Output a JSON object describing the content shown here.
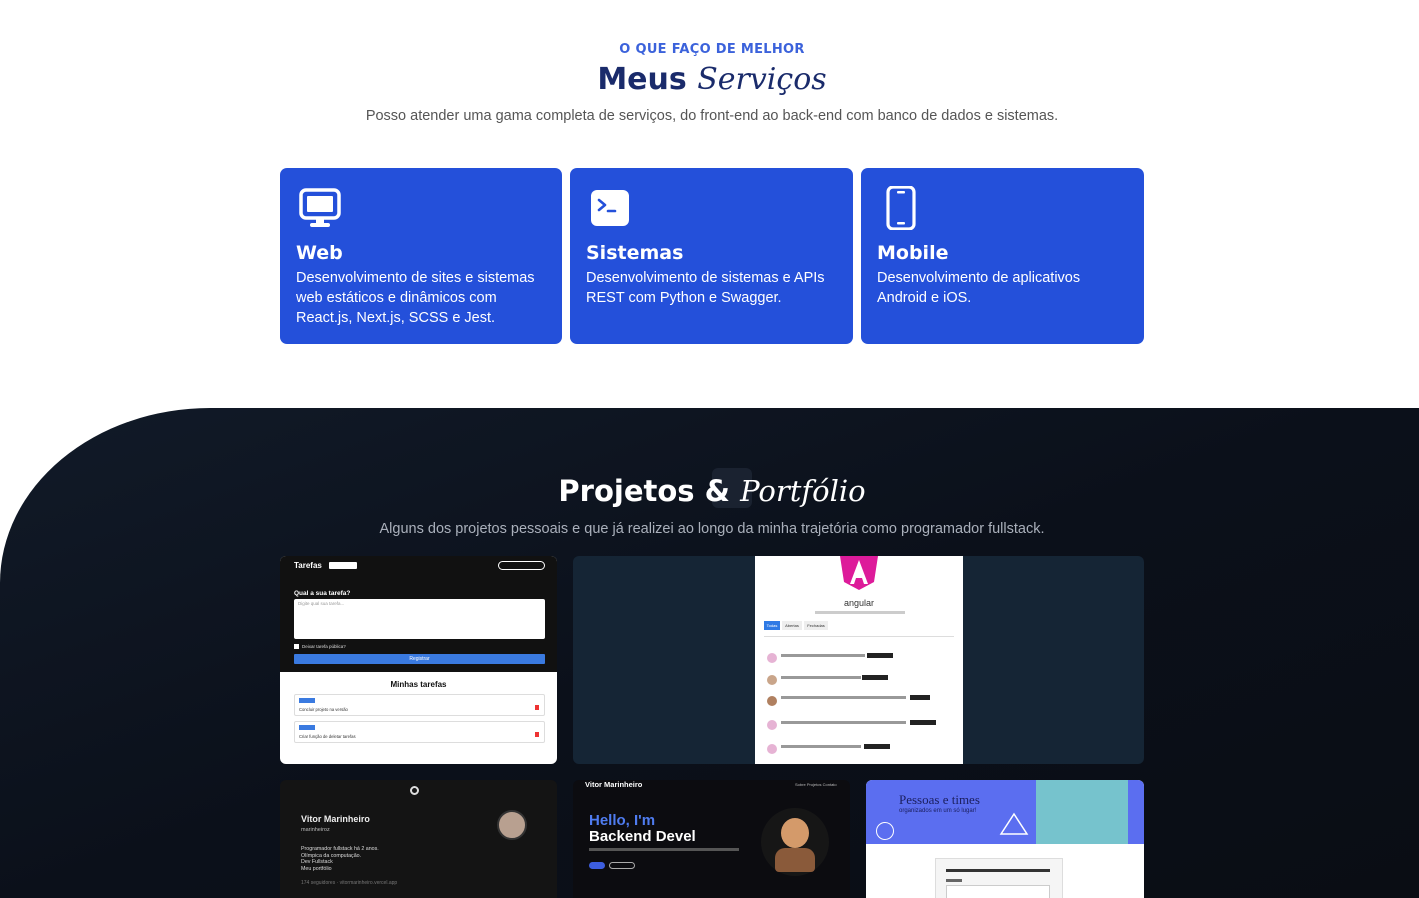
{
  "services": {
    "eyebrow": "O QUE FAÇO DE MELHOR",
    "title_bold": "Meus",
    "title_script": "Serviços",
    "subtitle": "Posso atender uma gama completa de serviços, do front-end ao back-end com banco de dados e sistemas.",
    "cards": [
      {
        "icon": "monitor-icon",
        "title": "Web",
        "desc": "Desenvolvimento de sites e sistemas web estáticos e dinâmicos com React.js, Next.js, SCSS e Jest."
      },
      {
        "icon": "terminal-icon",
        "title": "Sistemas",
        "desc": "Desenvolvimento de sistemas e APIs REST com Python e Swagger."
      },
      {
        "icon": "smartphone-icon",
        "title": "Mobile",
        "desc": "Desenvolvimento de aplicativos Android e iOS."
      }
    ],
    "accent": "#2450da"
  },
  "projects": {
    "title_bold": "Projetos &",
    "title_script": "Portfólio",
    "subtitle": "Alguns dos projetos pessoais e que já realizei ao longo da minha trajetória como programador fullstack.",
    "tarefas": {
      "logo": "Tarefas",
      "heading": "Qual a sua tarefa?",
      "placeholder": "Digite qual sua tarefa...",
      "checkbox": "Deixar tarefa pública?",
      "button": "Registrar",
      "list_title": "Minhas tarefas",
      "tag": "PUBLICO",
      "items": [
        "Concluir projeto na versão",
        "Criar função de deletar tarefas"
      ]
    },
    "angular": {
      "name": "angular",
      "tabs": [
        "Todas",
        "Abertas",
        "Fechadas"
      ]
    },
    "threads": {
      "name": "Vitor Marinheiro",
      "handle": "marinheiroz",
      "bio": [
        "Programador fullstack há 2 anos.",
        "Olímpica da computação.",
        "Dev Fullstack",
        "Meu portfólio"
      ],
      "footer": "174 seguidores · vitormarinheiro.vercel.app"
    },
    "portfolio": {
      "brand": "Vitor Marinheiro",
      "nav": [
        "Sobre",
        "Projetos",
        "Contato"
      ],
      "hello": "Hello, I'm",
      "role": "Backend Devel"
    },
    "pessoas": {
      "title": "Pessoas e times",
      "subtitle": "organizados em um só lugar!"
    }
  }
}
